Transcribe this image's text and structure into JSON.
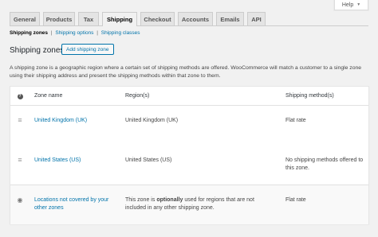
{
  "help": {
    "label": "Help"
  },
  "tabs": [
    {
      "label": "General"
    },
    {
      "label": "Products"
    },
    {
      "label": "Tax"
    },
    {
      "label": "Shipping"
    },
    {
      "label": "Checkout"
    },
    {
      "label": "Accounts"
    },
    {
      "label": "Emails"
    },
    {
      "label": "API"
    }
  ],
  "active_tab": "Shipping",
  "subnav": {
    "current": "Shipping zones",
    "options": "Shipping options",
    "classes": "Shipping classes",
    "separator": "|"
  },
  "heading": "Shipping zones",
  "add_button": "Add shipping zone",
  "description": "A shipping zone is a geographic region where a certain set of shipping methods are offered. WooCommerce will match a customer to a single zone using their shipping address and present the shipping methods within that zone to them.",
  "table": {
    "headers": {
      "name": "Zone name",
      "region": "Region(s)",
      "method": "Shipping method(s)"
    },
    "rows": [
      {
        "name": "United Kingdom (UK)",
        "region": "United Kingdom (UK)",
        "method": "Flat rate"
      },
      {
        "name": "United States (US)",
        "region": "United States (US)",
        "method": "No shipping methods offered to this zone."
      }
    ],
    "other": {
      "name": "Locations not covered by your other zones",
      "region_prefix": "This zone is",
      "region_emphasis": "optionally",
      "region_suffix": "used for regions that are not included in any other shipping zone.",
      "method": "Flat rate"
    }
  },
  "icons": {
    "help_caret": "caret-down-icon",
    "help_column": "question-icon",
    "drag_handle": "drag-handle-icon",
    "globe": "globe-icon"
  },
  "colors": {
    "link": "#0073aa",
    "background": "#f1f1f1",
    "panel": "#ffffff"
  }
}
